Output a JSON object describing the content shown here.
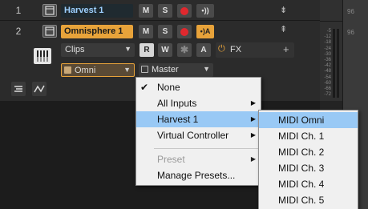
{
  "tracks": [
    {
      "number": "1",
      "name": "Harvest 1",
      "mute": "M",
      "solo": "S"
    },
    {
      "number": "2",
      "name": "Omnisphere 1",
      "mute": "M",
      "solo": "S"
    }
  ],
  "track2_row2": {
    "clips": "Clips",
    "r": "R",
    "w": "W",
    "star": "✱",
    "a": "A",
    "fx": "FX",
    "fx_add": "+"
  },
  "track2_row3": {
    "input": "Omni",
    "output": "Master"
  },
  "meter_scale": [
    "-5",
    "-12",
    "-18",
    "-24",
    "-30",
    "-36",
    "-42",
    "-48",
    "-54",
    "-60",
    "-66",
    "-72"
  ],
  "top_scale": [
    "96",
    "96"
  ],
  "input_menu": {
    "items": [
      {
        "label": "None",
        "checked": true
      },
      {
        "label": "All Inputs",
        "submenu": true
      },
      {
        "label": "Harvest 1",
        "submenu": true,
        "selected": true
      },
      {
        "label": "Virtual Controller",
        "submenu": true
      },
      {
        "label": "Preset",
        "submenu": true,
        "disabled": true
      },
      {
        "label": "Manage Presets..."
      }
    ]
  },
  "submenu": {
    "items": [
      "MIDI Omni",
      "MIDI Ch. 1",
      "MIDI Ch. 2",
      "MIDI Ch. 3",
      "MIDI Ch. 4",
      "MIDI Ch. 5"
    ]
  },
  "colors": {
    "accent_orange": "#e8a33a",
    "record_red": "#e0282e",
    "selection_blue": "#99c9f5",
    "active_blue": "#9ed0ff"
  }
}
